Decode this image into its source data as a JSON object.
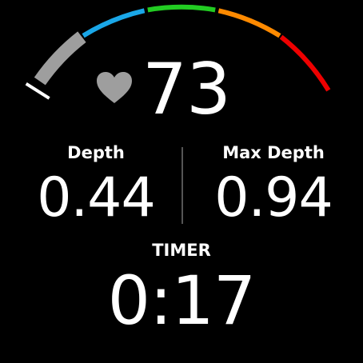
{
  "heart_rate": {
    "value": "73",
    "icon": "heart-icon",
    "zone_colors": {
      "zone1": "#9e9e9e",
      "zone2": "#1aa7e8",
      "zone3": "#22cc22",
      "zone4": "#ff8a00",
      "zone5": "#ee0000",
      "heart": "#9e9e9e",
      "marker": "#ffffff"
    }
  },
  "metrics": {
    "depth": {
      "label": "Depth",
      "value": "0.44"
    },
    "max_depth": {
      "label": "Max Depth",
      "value": "0.94"
    }
  },
  "timer": {
    "label": "TIMER",
    "value": "0:17"
  }
}
